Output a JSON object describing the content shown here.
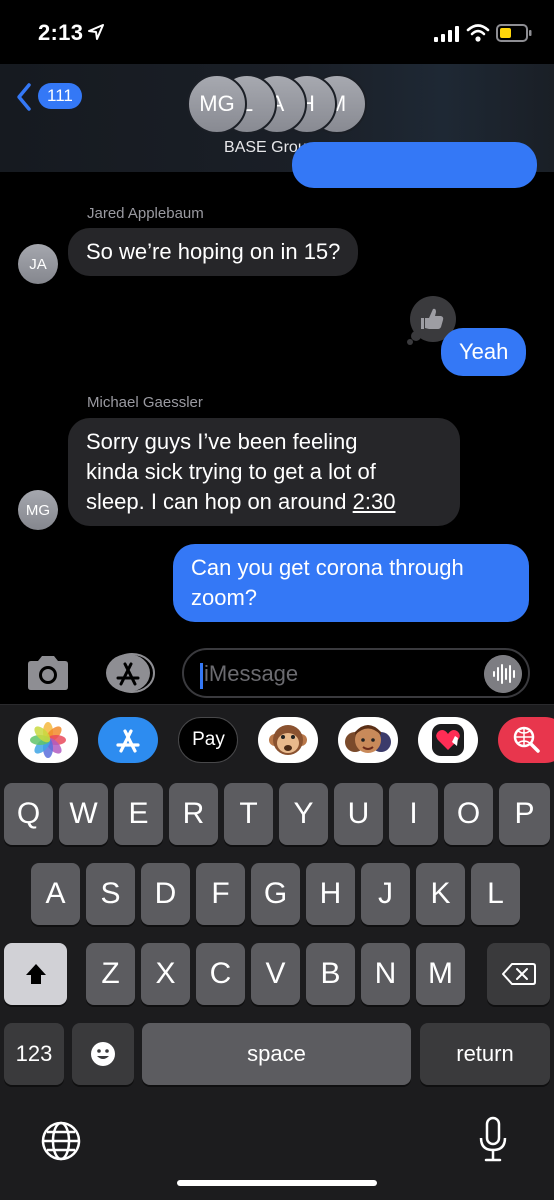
{
  "status_bar": {
    "time": "2:13"
  },
  "header": {
    "back_count": "111",
    "avatars": [
      "MG",
      "L",
      "A",
      "H",
      "M"
    ],
    "group_name": "BASE Group",
    "group_chevron": ">"
  },
  "messages": [
    {
      "sender": "Jared Applebaum",
      "avatar": "JA",
      "text": "So we’re hoping on in 15?"
    },
    {
      "text": "Yeah",
      "tapback": "thumbs-up-icon"
    },
    {
      "sender": "Michael Gaessler",
      "avatar": "MG",
      "lines": [
        "Sorry guys I’ve been feeling",
        "kinda sick trying to get a lot of",
        "sleep. I can hop on around "
      ],
      "link": "2:30"
    },
    {
      "lines": [
        "Can you get corona through",
        "zoom?"
      ]
    }
  ],
  "input": {
    "placeholder": "iMessage"
  },
  "app_strip": {
    "icons": [
      "photos-icon",
      "app-store-icon",
      "apple-pay-icon",
      "monkey-memoji-icon",
      "memoji-icon",
      "digital-touch-icon",
      "web-search-icon"
    ],
    "apple_pay_label": "Pay"
  },
  "keyboard": {
    "row1": [
      "Q",
      "W",
      "E",
      "R",
      "T",
      "Y",
      "U",
      "I",
      "O",
      "P"
    ],
    "row2": [
      "A",
      "S",
      "D",
      "F",
      "G",
      "H",
      "J",
      "K",
      "L"
    ],
    "row3": [
      "Z",
      "X",
      "C",
      "V",
      "B",
      "N",
      "M"
    ],
    "numbers_label": "123",
    "space_label": "space",
    "return_label": "return"
  }
}
